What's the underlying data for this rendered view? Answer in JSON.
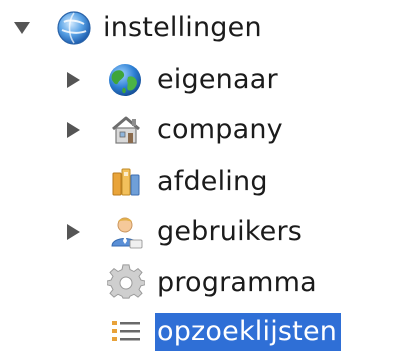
{
  "tree": {
    "root": {
      "label": "instellingen",
      "icon": "globe-icon",
      "expanded": true
    },
    "items": [
      {
        "label": "eigenaar",
        "icon": "earth-icon",
        "has_children": true,
        "selected": false
      },
      {
        "label": "company",
        "icon": "house-icon",
        "has_children": true,
        "selected": false
      },
      {
        "label": "afdeling",
        "icon": "department-icon",
        "has_children": false,
        "selected": false
      },
      {
        "label": "gebruikers",
        "icon": "user-icon",
        "has_children": true,
        "selected": false
      },
      {
        "label": "programma",
        "icon": "gear-icon",
        "has_children": false,
        "selected": false
      },
      {
        "label": "opzoeklijsten",
        "icon": "list-icon",
        "has_children": false,
        "selected": true
      }
    ]
  },
  "colors": {
    "selection": "#2f6fd6",
    "text": "#1b1b1b",
    "toggle": "#555555"
  }
}
